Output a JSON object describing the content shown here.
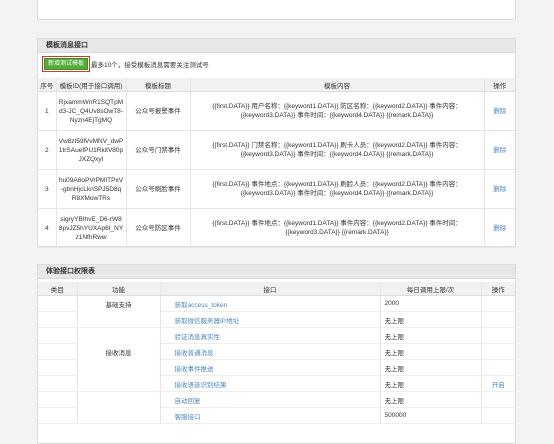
{
  "template_section": {
    "title": "模板消息接口",
    "add_button": "新增测试模板",
    "notice": "最多10个，接受模板消息需要关注测试号",
    "columns": [
      "序号",
      "模板ID(用于接口调用)",
      "模板标题",
      "模板内容",
      "操作"
    ],
    "rows": [
      {
        "index": "1",
        "id": "RjxammWnR1SQTpMd3-JC_Q4Uv8sOwT8-Nyzn4EjTgMQ",
        "title": "公众号报警事件",
        "content": "{{first.DATA}} 用户名称：{{keyword1.DATA}} 防区名称：{{keyword2.DATA}} 事件内容：{{keyword3.DATA}} 事件时间：{{keyword4.DATA}} {{remark.DATA}}",
        "action": "删除"
      },
      {
        "index": "2",
        "id": "Vw8zt59lVvMNV_dwP1trSAuefPU1RkitV80pJXZQxyI",
        "title": "公众号门禁事件",
        "content": "{{first.DATA}} 门禁名称：{{keyword1.DATA}} 刷卡人员：{{keyword2.DATA}} 事件内容：{{keyword3.DATA}} 事件时间：{{keyword4.DATA}} {{remark.DATA}}",
        "action": "删除"
      },
      {
        "index": "3",
        "id": "hu09A6oPVrPMITPxV-gbnHjcLknSPJ5D8qR8XMowTRs",
        "title": "公众号刷脸事件",
        "content": "{{first.DATA}} 事件地点：{{keyword1.DATA}} 刷脸人员：{{keyword2.DATA}} 事件内容：{{keyword3.DATA}} 事件时间：{{keyword4.DATA}} {{remark.DATA}}",
        "action": "删除"
      },
      {
        "index": "4",
        "id": "sigryYBIhvE_D6-rW88pvJZ5hYUXAp6I_NYz1NfhRww",
        "title": "公众号防区事件",
        "content": "{{first.DATA}} 事件地点：{{keyword1.DATA}} 事件内容：{{keyword2.DATA}} 事件时间：{{keyword3.DATA}} {{remark.DATA}}",
        "action": "删除"
      }
    ]
  },
  "api_section": {
    "title": "体验接口权限表",
    "columns": [
      "类目",
      "功能",
      "接口",
      "每日调用上限/次",
      "操作"
    ],
    "rows": [
      {
        "category": "",
        "function": "基础支持",
        "interface": "获取access_token",
        "limit": "2000",
        "action": ""
      },
      {
        "category": "",
        "function": "",
        "interface": "获取微信服务器IP地址",
        "limit": "无上限",
        "action": ""
      },
      {
        "category": "",
        "function": "",
        "interface": "验证消息真实性",
        "limit": "无上限",
        "action": ""
      },
      {
        "category": "",
        "function": "接收消息",
        "interface": "接收普通消息",
        "limit": "无上限",
        "action": ""
      },
      {
        "category": "",
        "function": "",
        "interface": "接收事件推送",
        "limit": "无上限",
        "action": ""
      },
      {
        "category": "",
        "function": "",
        "interface": "接收语音识别结果",
        "limit": "无上限",
        "action": "开启"
      },
      {
        "category": "",
        "function": "",
        "interface": "自动回复",
        "limit": "无上限",
        "action": ""
      },
      {
        "category": "",
        "function": "",
        "interface": "客服接口",
        "limit": "500000",
        "action": ""
      }
    ]
  }
}
